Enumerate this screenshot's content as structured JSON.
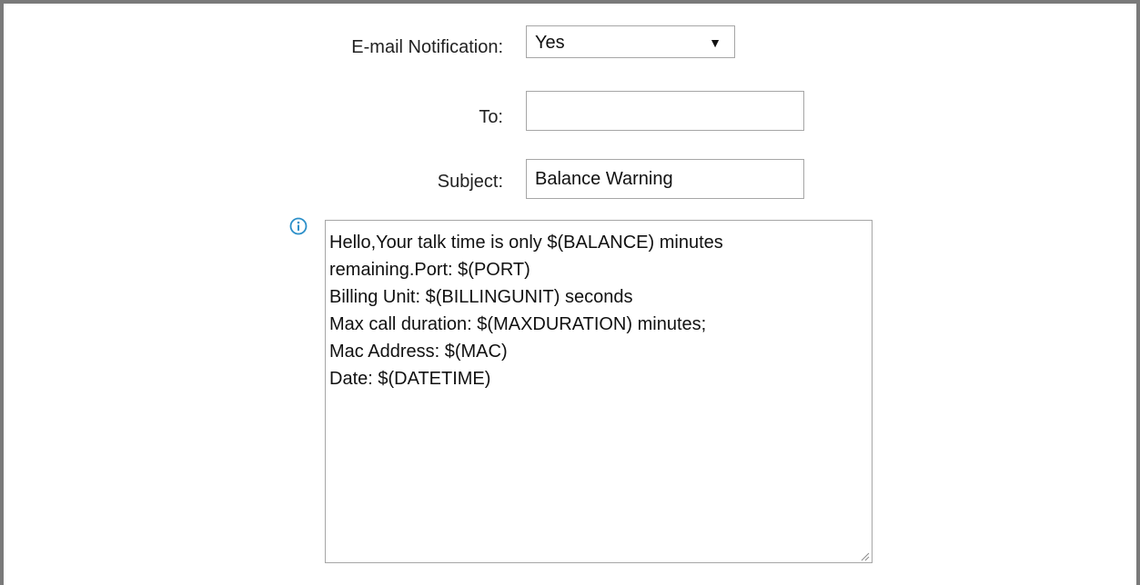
{
  "email_notification": {
    "label": "E-mail Notification:",
    "selected": "Yes",
    "arrow": "▼"
  },
  "to": {
    "label": "To:",
    "value": ""
  },
  "subject": {
    "label": "Subject:",
    "value": "Balance Warning"
  },
  "message": {
    "info_icon": "info-icon",
    "lines": [
      "Hello,Your talk time is only $(BALANCE) minutes",
      "remaining.Port: $(PORT)",
      "Billing Unit: $(BILLINGUNIT) seconds",
      "Max call duration: $(MAXDURATION) minutes;",
      "Mac Address: $(MAC)",
      "Date: $(DATETIME)"
    ]
  },
  "colors": {
    "frame_border": "#7a7a7a",
    "input_border": "#a6a6a6",
    "info_icon": "#2b8fc9"
  }
}
